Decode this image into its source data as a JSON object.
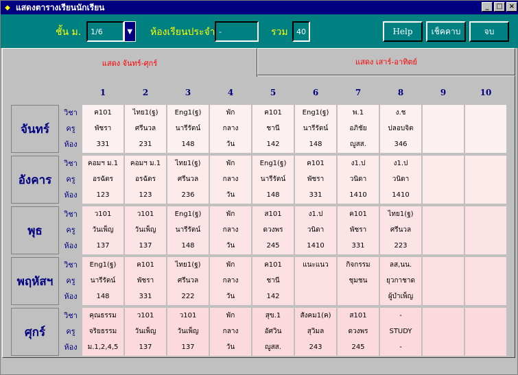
{
  "window": {
    "title": "แสดงตารางเรียนนักเรียน",
    "controls": {
      "minimize": "_",
      "maximize": "□",
      "close": "×"
    }
  },
  "toolbar": {
    "grade_label": "ชั้น ม.",
    "grade_value": "1/6",
    "homeroom_label": "ห้องเรียนประจำ",
    "homeroom_value": "-",
    "total_label": "รวม",
    "total_value": "40",
    "help_label": "Help",
    "check_label": "เช็คคาบ",
    "exit_label": "จบ"
  },
  "tabs": [
    {
      "label": "แสดง จันทร์-ศุกร์",
      "active": true
    },
    {
      "label": "แสดง เสาร์-อาทิตย์",
      "active": false
    }
  ],
  "periods": [
    "1",
    "2",
    "3",
    "4",
    "5",
    "6",
    "7",
    "8",
    "9",
    "10"
  ],
  "row_labels": {
    "subject": "วิชา",
    "teacher": "ครู",
    "room": "ห้อง"
  },
  "days": [
    {
      "name": "จันทร์",
      "bg": "#fdf0f0",
      "slots": [
        [
          "ค101",
          "พัชรา",
          "331"
        ],
        [
          "ไทย1(ฐ)",
          "ศรีนวล",
          "231"
        ],
        [
          "Eng1(ฐ)",
          "นารีรัตน์",
          "148"
        ],
        [
          "พัก",
          "กลาง",
          "วัน"
        ],
        [
          "ค101",
          "ชานี",
          "142"
        ],
        [
          "Eng1(ฐ)",
          "นารีรัตน์",
          "148"
        ],
        [
          "พ.1",
          "อภิชัย",
          "ญูสส."
        ],
        [
          "ง.ช",
          "ปลอบจิต",
          "346"
        ],
        [
          "",
          "",
          ""
        ],
        [
          "",
          "",
          ""
        ]
      ]
    },
    {
      "name": "อังคาร",
      "bg": "#fdeaea",
      "slots": [
        [
          "คอมฯ ม.1",
          "อรฉัตร",
          "123"
        ],
        [
          "คอมฯ ม.1",
          "อรฉัตร",
          "123"
        ],
        [
          "ไทย1(ฐ)",
          "ศรีนวล",
          "236"
        ],
        [
          "พัก",
          "กลาง",
          "วัน"
        ],
        [
          "Eng1(ฐ)",
          "นารีรัตน์",
          "148"
        ],
        [
          "ค101",
          "พัชรา",
          "331"
        ],
        [
          "ง1.ป",
          "วนิดา",
          "1410"
        ],
        [
          "ง1.ป",
          "วนิดา",
          "1410"
        ],
        [
          "",
          "",
          ""
        ],
        [
          "",
          "",
          ""
        ]
      ]
    },
    {
      "name": "พุธ",
      "bg": "#fce4e6",
      "slots": [
        [
          "ว101",
          "วันเพ็ญ",
          "137"
        ],
        [
          "ว101",
          "วันเพ็ญ",
          "137"
        ],
        [
          "Eng1(ฐ)",
          "นารีรัตน์",
          "148"
        ],
        [
          "พัก",
          "กลาง",
          "วัน"
        ],
        [
          "ส101",
          "ดวงพร",
          "245"
        ],
        [
          "ง1.ป",
          "วนิดา",
          "1410"
        ],
        [
          "ค101",
          "พัชรา",
          "331"
        ],
        [
          "ไทย1(ฐ)",
          "ศรีนวล",
          "223"
        ],
        [
          "",
          "",
          ""
        ],
        [
          "",
          "",
          ""
        ]
      ]
    },
    {
      "name": "พฤหัสฯ",
      "bg": "#fbdfe1",
      "slots": [
        [
          "Eng1(ฐ)",
          "นารีรัตน์",
          "148"
        ],
        [
          "ค101",
          "พัชรา",
          "331"
        ],
        [
          "ไทย1(ฐ)",
          "ศรีนวล",
          "222"
        ],
        [
          "พัก",
          "กลาง",
          "วัน"
        ],
        [
          "ค101",
          "ชานี",
          "142"
        ],
        [
          "แนะแนว",
          "",
          ""
        ],
        [
          "กิจกรรม",
          "ชุมชน",
          ""
        ],
        [
          "ลส,นน.",
          "ยุวกาชาด",
          "ผู้บำเพ็ญ"
        ],
        [
          "",
          "",
          ""
        ],
        [
          "",
          "",
          ""
        ]
      ]
    },
    {
      "name": "ศุกร์",
      "bg": "#fbd9dc",
      "slots": [
        [
          "คุณธรรม",
          "จริยธรรม",
          "ม.1,2,4,5"
        ],
        [
          "ว101",
          "วันเพ็ญ",
          "137"
        ],
        [
          "ว101",
          "วันเพ็ญ",
          "137"
        ],
        [
          "พัก",
          "กลาง",
          "วัน"
        ],
        [
          "สุข.1",
          "อัศวิน",
          "ญูสส."
        ],
        [
          "สังคม1(ค)",
          "สุวิมล",
          "243"
        ],
        [
          "ส101",
          "ดวงพร",
          "245"
        ],
        [
          "-",
          "STUDY",
          "-"
        ],
        [
          "",
          "",
          ""
        ],
        [
          "",
          "",
          ""
        ]
      ]
    }
  ]
}
